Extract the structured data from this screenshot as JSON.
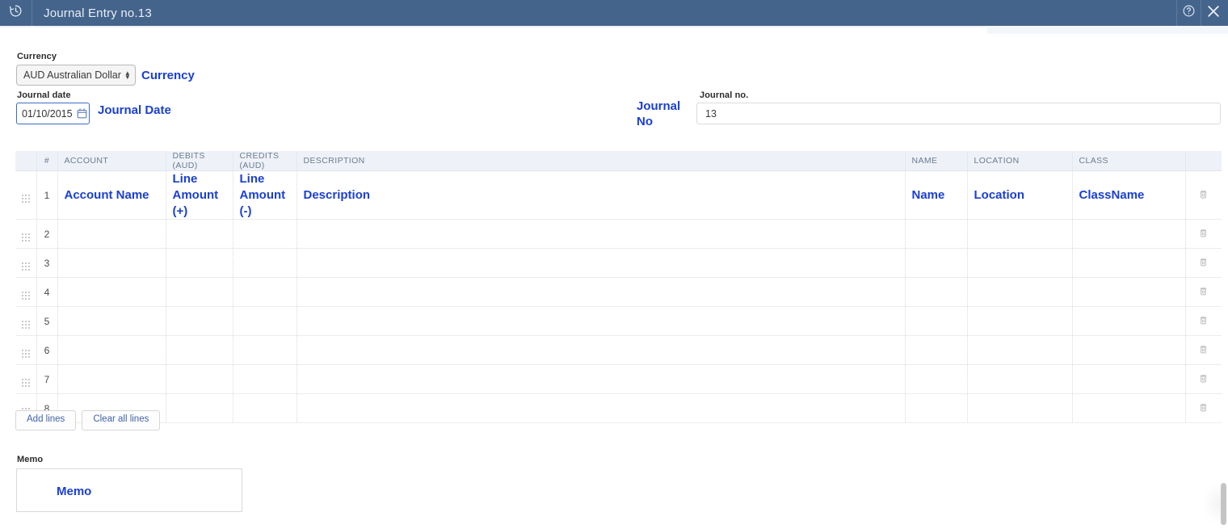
{
  "titlebar": {
    "app_icon": "history-clock-icon",
    "title": "Journal Entry  no.13",
    "help_icon": "help-circle-icon",
    "close_icon": "close-icon",
    "background": "#44648c"
  },
  "annotation_color": "#1a3fd4",
  "form": {
    "currency": {
      "label": "Currency",
      "value": "AUD Australian Dollar",
      "annotation": "Currency"
    },
    "journal_date": {
      "label": "Journal date",
      "value": "01/10/2015",
      "annotation": "Journal Date",
      "calendar_icon": "calendar-icon"
    },
    "journal_no": {
      "label": "Journal no.",
      "value": "13",
      "annotation": "Journal No"
    }
  },
  "table": {
    "columns": [
      {
        "key": "handle",
        "label": ""
      },
      {
        "key": "num",
        "label": "#"
      },
      {
        "key": "account",
        "label": "ACCOUNT"
      },
      {
        "key": "debits",
        "label": "DEBITS (AUD)"
      },
      {
        "key": "credits",
        "label": "CREDITS (AUD)"
      },
      {
        "key": "description",
        "label": "DESCRIPTION"
      },
      {
        "key": "name",
        "label": "NAME"
      },
      {
        "key": "location",
        "label": "LOCATION"
      },
      {
        "key": "class",
        "label": "CLASS"
      },
      {
        "key": "delete",
        "label": ""
      }
    ],
    "annotations": {
      "account": "Account Name",
      "debits": "Line Amount (+)",
      "credits": "Line Amount (-)",
      "description": "Description",
      "name": "Name",
      "location": "Location",
      "class": "ClassName"
    },
    "rows": [
      {
        "num": "1",
        "account": "",
        "debits": "",
        "credits": "",
        "description": "",
        "name": "",
        "location": "",
        "class": ""
      },
      {
        "num": "2",
        "account": "",
        "debits": "",
        "credits": "",
        "description": "",
        "name": "",
        "location": "",
        "class": ""
      },
      {
        "num": "3",
        "account": "",
        "debits": "",
        "credits": "",
        "description": "",
        "name": "",
        "location": "",
        "class": ""
      },
      {
        "num": "4",
        "account": "",
        "debits": "",
        "credits": "",
        "description": "",
        "name": "",
        "location": "",
        "class": ""
      },
      {
        "num": "5",
        "account": "",
        "debits": "",
        "credits": "",
        "description": "",
        "name": "",
        "location": "",
        "class": ""
      },
      {
        "num": "6",
        "account": "",
        "debits": "",
        "credits": "",
        "description": "",
        "name": "",
        "location": "",
        "class": ""
      },
      {
        "num": "7",
        "account": "",
        "debits": "",
        "credits": "",
        "description": "",
        "name": "",
        "location": "",
        "class": ""
      },
      {
        "num": "8",
        "account": "",
        "debits": "",
        "credits": "",
        "description": "",
        "name": "",
        "location": "",
        "class": ""
      }
    ],
    "row_icons": {
      "drag_handle": "drag-handle-icon",
      "delete": "trash-icon"
    }
  },
  "buttons": {
    "add_lines": "Add lines",
    "clear_all_lines": "Clear all lines"
  },
  "memo": {
    "label": "Memo",
    "value": "",
    "annotation": "Memo"
  }
}
